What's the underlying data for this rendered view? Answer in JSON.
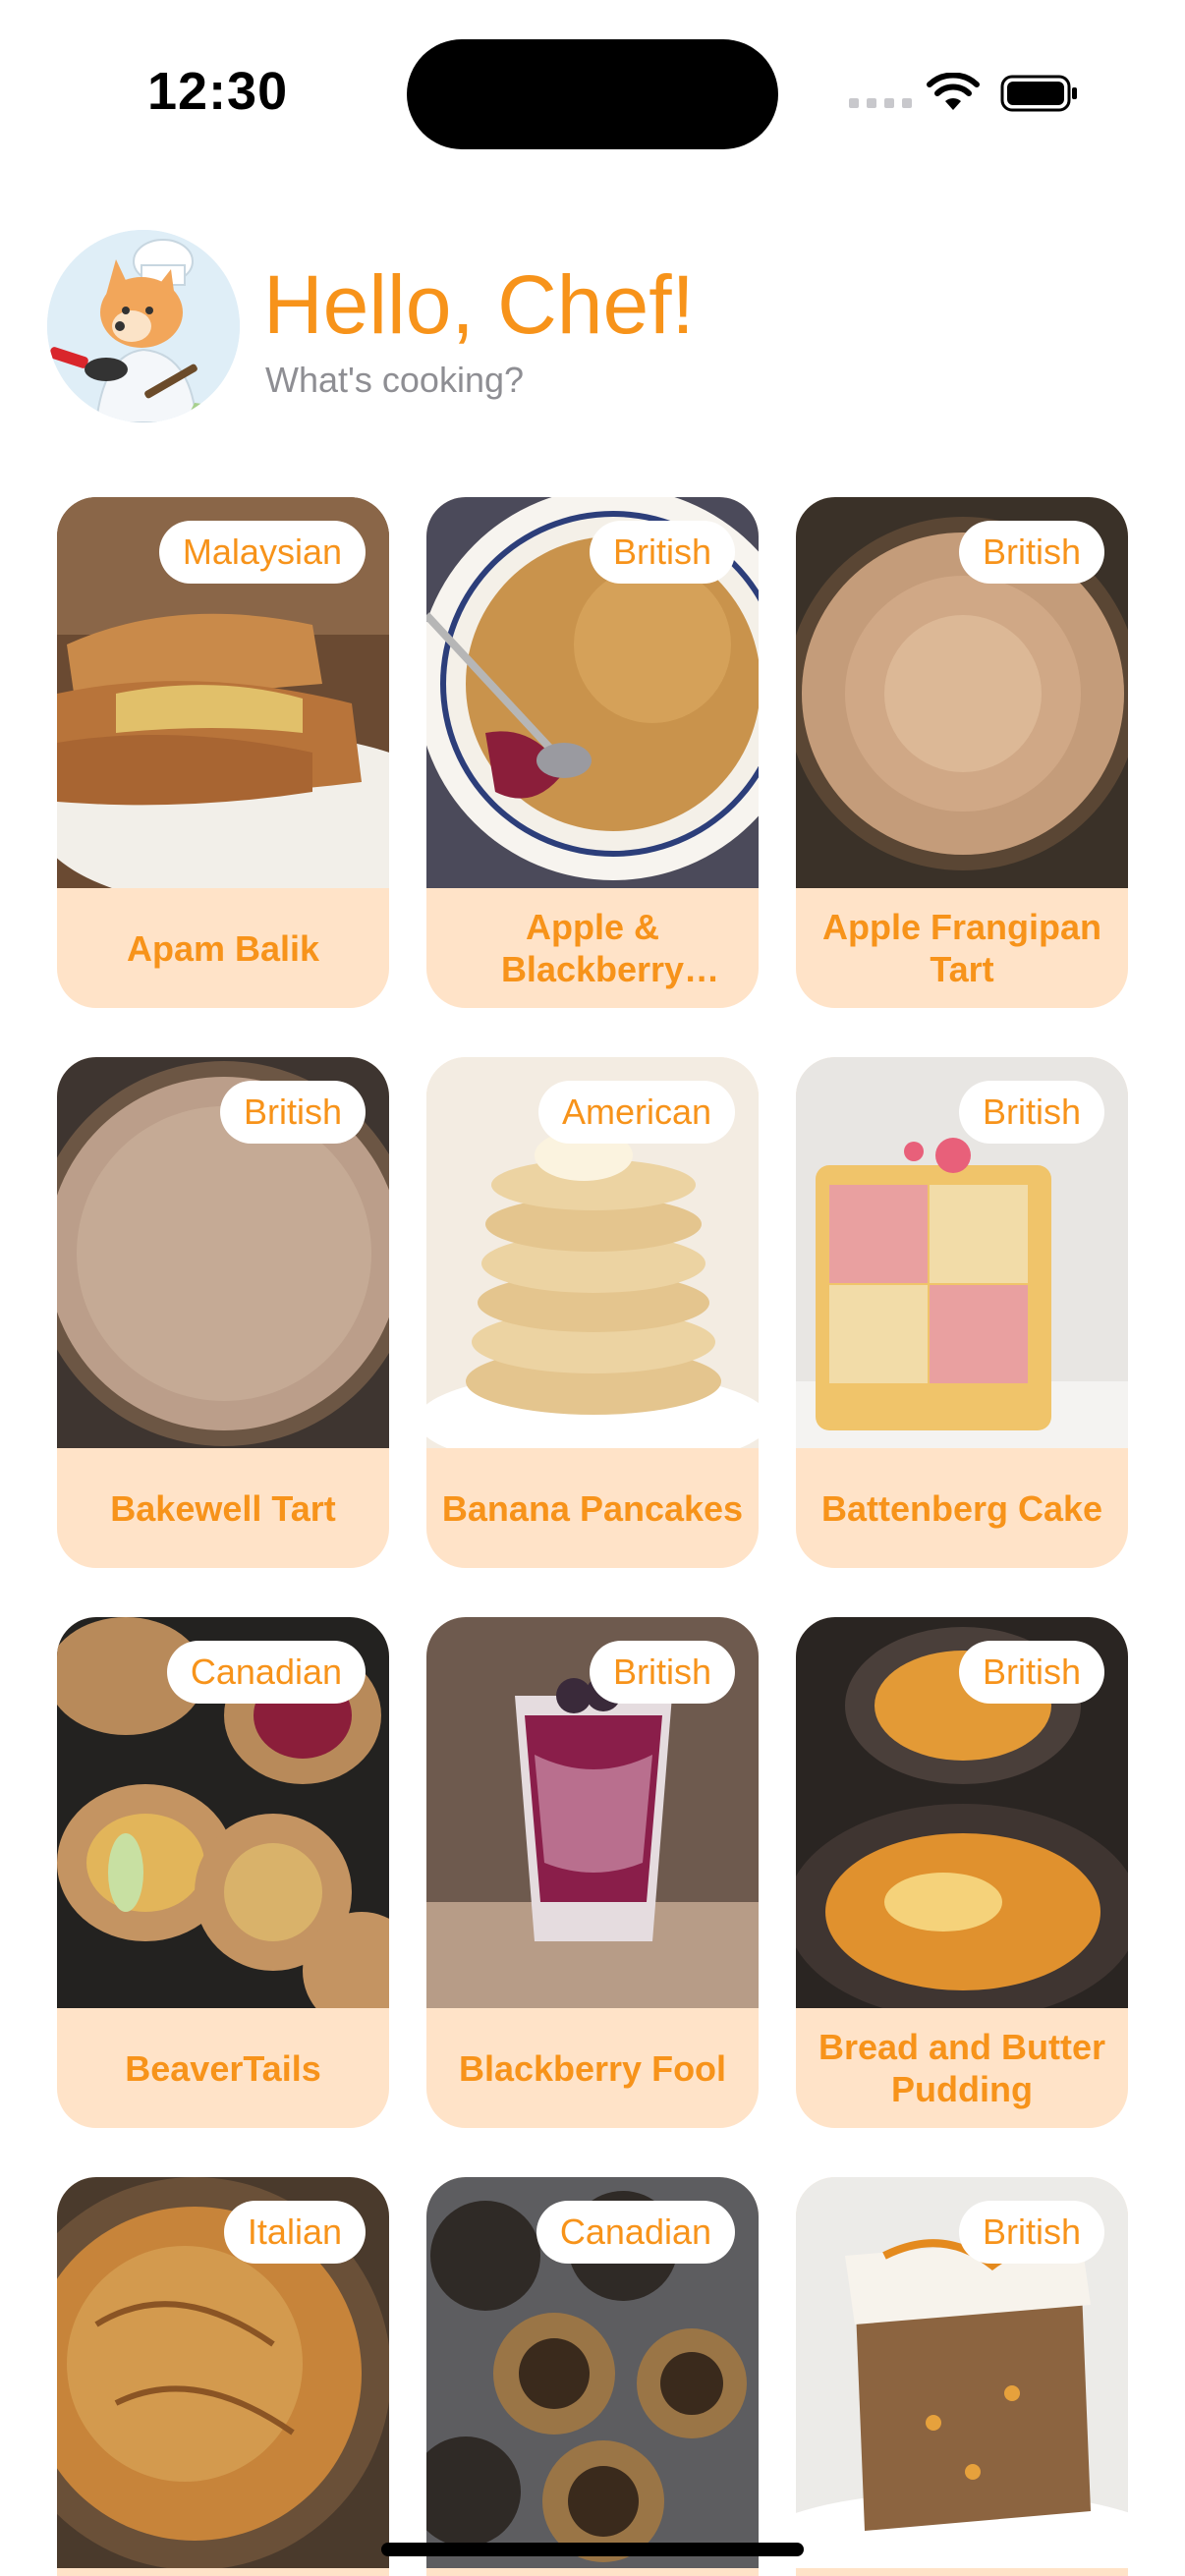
{
  "status_bar": {
    "time": "12:30",
    "icons": [
      "cellular-signal-icon",
      "wifi-icon",
      "battery-icon"
    ]
  },
  "header": {
    "greeting": "Hello, Chef!",
    "subtitle": "What's cooking?",
    "avatar_icon": "chef-fox-avatar"
  },
  "colors": {
    "accent": "#f7931a",
    "card_bg": "#ffe3c8",
    "badge_bg": "#ffffff",
    "subtitle": "#8e8e93"
  },
  "recipes": [
    {
      "title": "Apam Balik",
      "cuisine": "Malaysian"
    },
    {
      "title": "Apple & Blackberry Crumble",
      "cuisine": "British"
    },
    {
      "title": "Apple Frangipan Tart",
      "cuisine": "British"
    },
    {
      "title": "Bakewell Tart",
      "cuisine": "British"
    },
    {
      "title": "Banana Pancakes",
      "cuisine": "American"
    },
    {
      "title": "Battenberg Cake",
      "cuisine": "British"
    },
    {
      "title": "BeaverTails",
      "cuisine": "Canadian"
    },
    {
      "title": "Blackberry Fool",
      "cuisine": "British"
    },
    {
      "title": "Bread and Butter Pudding",
      "cuisine": "British"
    },
    {
      "title": "",
      "cuisine": "Italian"
    },
    {
      "title": "",
      "cuisine": "Canadian"
    },
    {
      "title": "",
      "cuisine": "British"
    }
  ]
}
